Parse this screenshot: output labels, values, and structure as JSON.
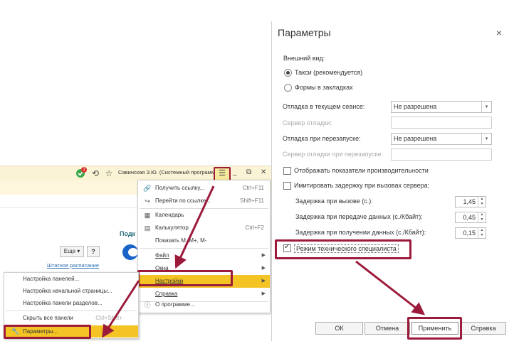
{
  "app": {
    "user_name": "Савинская З.Ю. (Системный программист)",
    "notification_count": "1",
    "background_heading": "Подк",
    "more_button": "Еще",
    "more_caret": "▾",
    "help_button": "?",
    "staff_link": "Штатное расписание"
  },
  "main_menu": {
    "items": [
      {
        "label": "Получить ссылку...",
        "shortcut": "Ctrl+F11"
      },
      {
        "label": "Перейти по ссылке...",
        "shortcut": "Shift+F11"
      },
      {
        "label": "Календарь",
        "shortcut": ""
      },
      {
        "label": "Калькулятор",
        "shortcut": "Ctrl+F2"
      },
      {
        "label": "Показать M, M+, M-",
        "shortcut": ""
      },
      {
        "label": "Файл",
        "shortcut": ""
      },
      {
        "label": "Окна",
        "shortcut": ""
      },
      {
        "label": "Настройки",
        "shortcut": ""
      },
      {
        "label": "Справка",
        "shortcut": ""
      },
      {
        "label": "О программе...",
        "shortcut": ""
      }
    ]
  },
  "sub_menu": {
    "items": [
      {
        "label": "Настройка панелей...",
        "shortcut": ""
      },
      {
        "label": "Настройка начальной страницы...",
        "shortcut": ""
      },
      {
        "label": "Настройка панели разделов...",
        "shortcut": ""
      },
      {
        "label": "Скрыть все панели",
        "shortcut": "Ctrl+Shift+"
      },
      {
        "label": "Параметры...",
        "shortcut": ""
      }
    ]
  },
  "dialog": {
    "title": "Параметры",
    "close": "×",
    "appearance_label": "Внешний вид:",
    "radio_taxi": "Такси (рекомендуется)",
    "radio_tabs": "Формы в закладках",
    "debug_session_label": "Отладка в текущем сеансе:",
    "debug_session_value": "Не разрешена",
    "debug_server_label": "Сервер отладки:",
    "debug_restart_label": "Отладка при перезапуске:",
    "debug_restart_value": "Не разрешена",
    "debug_restart_server_label": "Сервер отладки при перезапуске:",
    "show_perf_label": "Отображать показатели производительности",
    "simulate_delay_label": "Имитировать задержку при вызовах сервера:",
    "delay_call_label": "Задержка при вызове (с.):",
    "delay_call_value": "1,45",
    "delay_send_label": "Задержка при передаче данных (с./Кбайт):",
    "delay_send_value": "0,45",
    "delay_receive_label": "Задержка при получении данных (с./Кбайт):",
    "delay_receive_value": "0,15",
    "tech_mode_label": "Режим технического специалиста",
    "ok_button": "ОК",
    "cancel_button": "Отмена",
    "apply_button": "Применить",
    "help_button": "Справка"
  },
  "colors": {
    "accent": "#9c1a3a",
    "highlight": "#f4c425"
  }
}
